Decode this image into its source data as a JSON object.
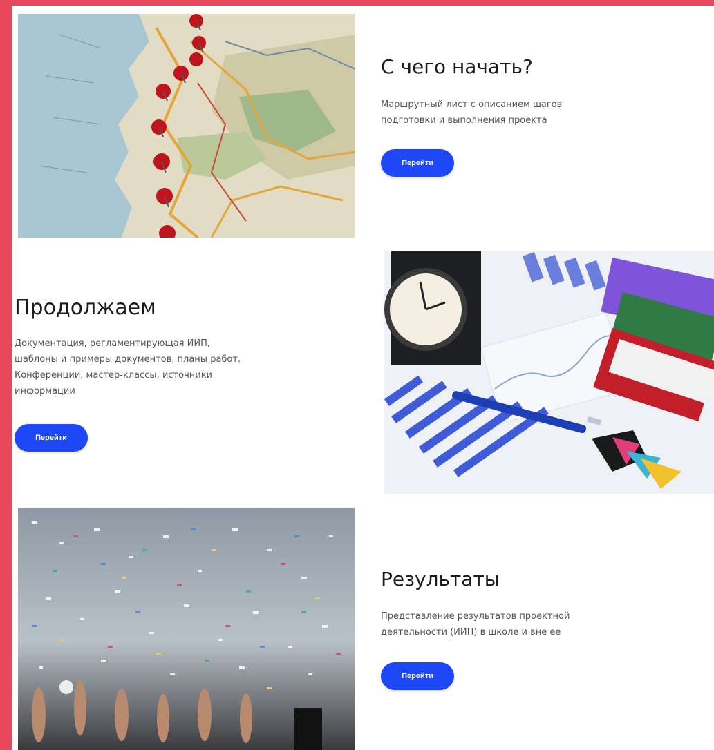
{
  "cards": [
    {
      "title": "С чего начать?",
      "description": "Маршрутный лист с описанием шагов\nподготовки и выполнения проекта",
      "button_label": "Перейти",
      "image": "map-with-pins"
    },
    {
      "title": "Продолжаем",
      "description": "Документация, регламентирующая ИИП,\nшаблоны и примеры документов, планы работ.\nКонференции, мастер-классы, источники\nинформации",
      "button_label": "Перейти",
      "image": "office-charts-clock-books"
    },
    {
      "title": "Результаты",
      "description": "Представление результатов проектной\nдеятельности (ИИП) в школе и вне ее",
      "button_label": "Перейти",
      "image": "confetti-crowd"
    }
  ],
  "colors": {
    "frame": "#e8465a",
    "button": "#1e47f5",
    "heading": "#1b1b1b",
    "text": "#555555"
  }
}
